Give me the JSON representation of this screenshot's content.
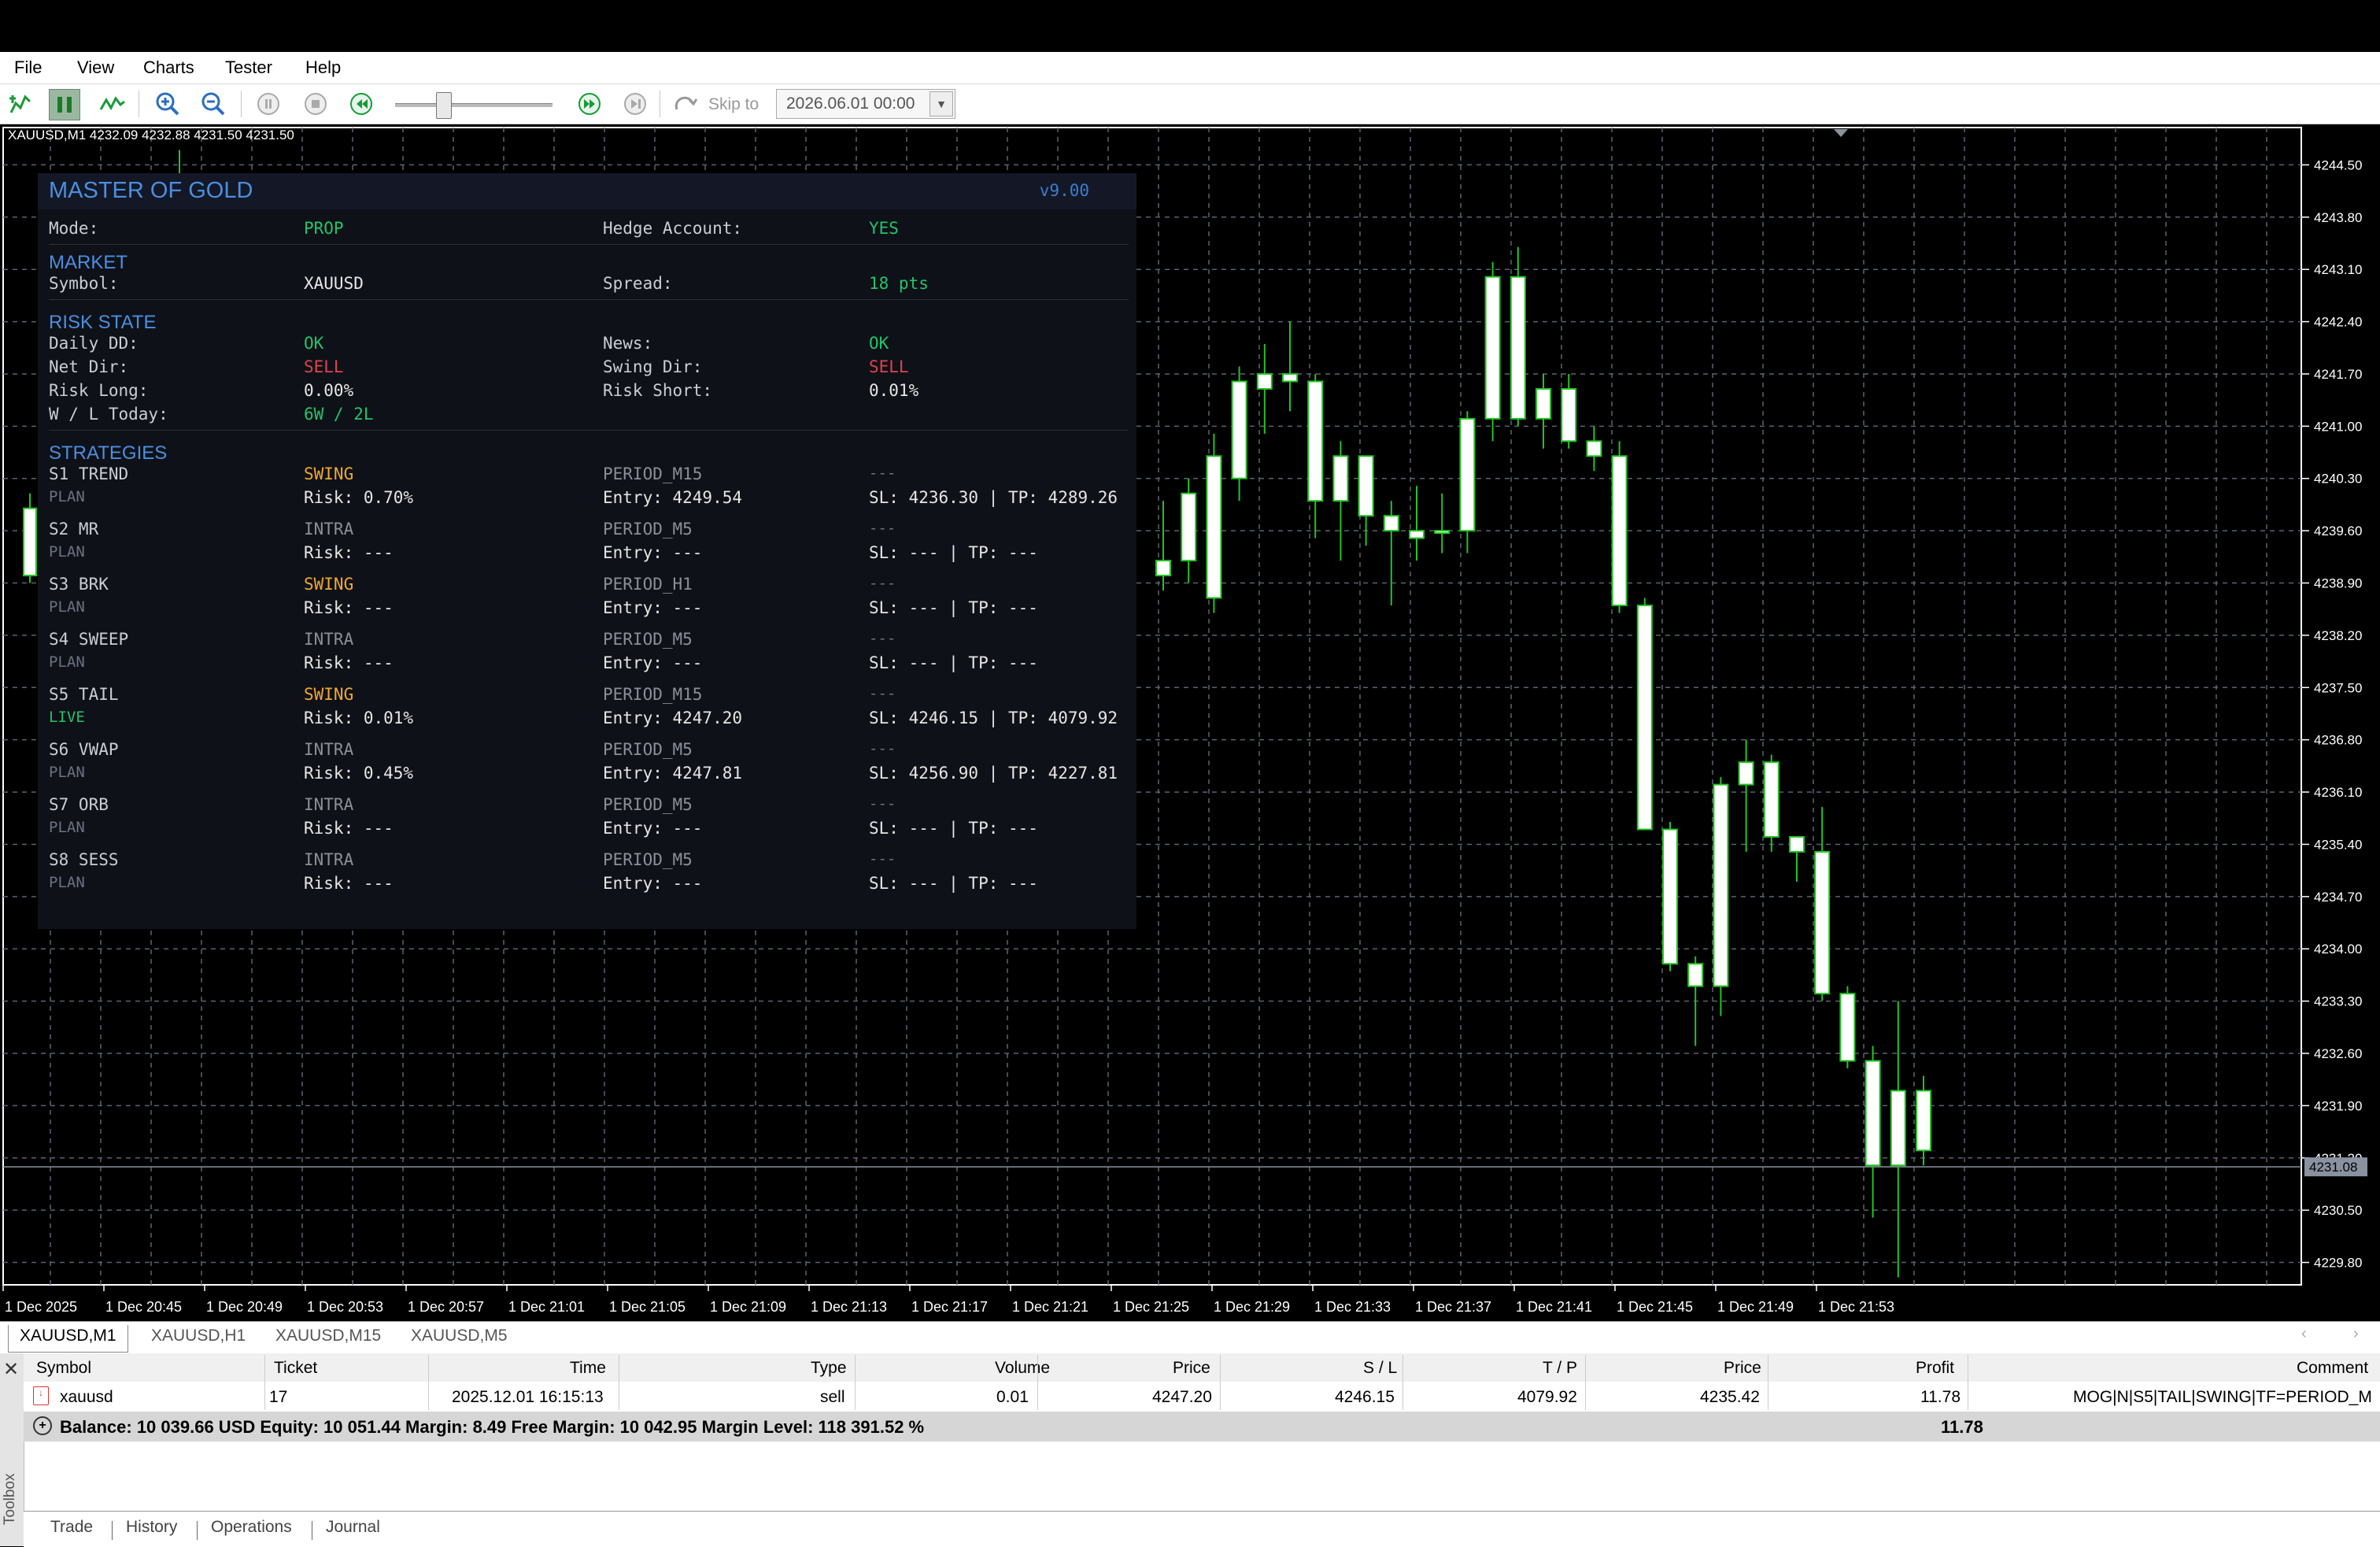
{
  "menu": [
    "File",
    "View",
    "Charts",
    "Tester",
    "Help"
  ],
  "toolbar": {
    "skip_label": "Skip to",
    "skip_date": "2026.06.01 00:00",
    "icons": [
      "new-order-icon",
      "pause-icon",
      "indicators-icon",
      "zoom-in-icon",
      "zoom-out-icon",
      "stop-icon",
      "stop-square-icon",
      "rewind-icon",
      "fast-forward-icon",
      "step-icon",
      "skip-to-icon"
    ]
  },
  "chart": {
    "title": "XAUUSD,M1  4232.09 4232.88 4231.50 4231.50",
    "price_labels": [
      "4244.50",
      "4243.80",
      "4243.10",
      "4242.40",
      "4241.70",
      "4241.00",
      "4240.30",
      "4239.60",
      "4238.90",
      "4238.20",
      "4237.50",
      "4236.80",
      "4236.10",
      "4235.40",
      "4234.70",
      "4234.00",
      "4233.30",
      "4232.60",
      "4231.90",
      "4231.20",
      "4230.50",
      "4229.80"
    ],
    "current_price": "4231.08",
    "time_labels": [
      "1 Dec 2025",
      "1 Dec 20:45",
      "1 Dec 20:49",
      "1 Dec 20:53",
      "1 Dec 20:57",
      "1 Dec 21:01",
      "1 Dec 21:05",
      "1 Dec 21:09",
      "1 Dec 21:13",
      "1 Dec 21:17",
      "1 Dec 21:21",
      "1 Dec 21:25",
      "1 Dec 21:29",
      "1 Dec 21:33",
      "1 Dec 21:37",
      "1 Dec 21:41",
      "1 Dec 21:45",
      "1 Dec 21:49",
      "1 Dec 21:53"
    ],
    "colors": {
      "background": "#000000",
      "grid": "#5a6270",
      "bull": "#ffffff",
      "wick": "#22c422",
      "axis_text": "#ffffff"
    }
  },
  "chart_data": {
    "type": "candlestick",
    "symbol": "XAUUSD,M1",
    "ylim": [
      4229.5,
      4245.0
    ],
    "candles": [
      {
        "o": 4239.0,
        "h": 4240.0,
        "l": 4238.8,
        "c": 4239.2
      },
      {
        "o": 4239.2,
        "h": 4240.3,
        "l": 4238.9,
        "c": 4240.1
      },
      {
        "o": 4238.7,
        "h": 4240.9,
        "l": 4238.5,
        "c": 4240.6
      },
      {
        "o": 4240.3,
        "h": 4241.8,
        "l": 4240.0,
        "c": 4241.6
      },
      {
        "o": 4241.5,
        "h": 4242.1,
        "l": 4240.9,
        "c": 4241.7
      },
      {
        "o": 4241.7,
        "h": 4242.4,
        "l": 4241.2,
        "c": 4241.6
      },
      {
        "o": 4241.6,
        "h": 4241.7,
        "l": 4239.5,
        "c": 4240.0
      },
      {
        "o": 4240.0,
        "h": 4240.8,
        "l": 4239.2,
        "c": 4240.6
      },
      {
        "o": 4240.6,
        "h": 4240.6,
        "l": 4239.4,
        "c": 4239.8
      },
      {
        "o": 4239.8,
        "h": 4240.0,
        "l": 4238.6,
        "c": 4239.6
      },
      {
        "o": 4239.6,
        "h": 4240.2,
        "l": 4239.2,
        "c": 4239.5
      },
      {
        "o": 4239.6,
        "h": 4240.1,
        "l": 4239.3,
        "c": 4239.6
      },
      {
        "o": 4239.6,
        "h": 4241.2,
        "l": 4239.3,
        "c": 4241.1
      },
      {
        "o": 4241.1,
        "h": 4243.2,
        "l": 4240.8,
        "c": 4243.0
      },
      {
        "o": 4241.1,
        "h": 4243.4,
        "l": 4241.0,
        "c": 4243.0
      },
      {
        "o": 4241.1,
        "h": 4241.7,
        "l": 4240.7,
        "c": 4241.5
      },
      {
        "o": 4241.5,
        "h": 4241.7,
        "l": 4240.7,
        "c": 4240.8
      },
      {
        "o": 4240.8,
        "h": 4241.0,
        "l": 4240.4,
        "c": 4240.6
      },
      {
        "o": 4240.6,
        "h": 4240.8,
        "l": 4238.5,
        "c": 4238.6
      },
      {
        "o": 4238.6,
        "h": 4238.7,
        "l": 4235.6,
        "c": 4235.6
      },
      {
        "o": 4235.6,
        "h": 4235.7,
        "l": 4233.7,
        "c": 4233.8
      },
      {
        "o": 4233.8,
        "h": 4233.9,
        "l": 4232.7,
        "c": 4233.5
      },
      {
        "o": 4233.5,
        "h": 4236.3,
        "l": 4233.1,
        "c": 4236.2
      },
      {
        "o": 4236.2,
        "h": 4236.8,
        "l": 4235.3,
        "c": 4236.5
      },
      {
        "o": 4236.5,
        "h": 4236.6,
        "l": 4235.3,
        "c": 4235.5
      },
      {
        "o": 4235.5,
        "h": 4235.5,
        "l": 4234.9,
        "c": 4235.3
      },
      {
        "o": 4235.3,
        "h": 4235.9,
        "l": 4233.3,
        "c": 4233.4
      },
      {
        "o": 4233.4,
        "h": 4233.5,
        "l": 4232.4,
        "c": 4232.5
      },
      {
        "o": 4232.5,
        "h": 4232.7,
        "l": 4230.4,
        "c": 4231.1
      },
      {
        "o": 4231.1,
        "h": 4233.3,
        "l": 4229.6,
        "c": 4232.1
      },
      {
        "o": 4232.1,
        "h": 4232.3,
        "l": 4231.1,
        "c": 4231.3
      }
    ]
  },
  "ea": {
    "title": "MASTER OF GOLD",
    "version": "v9.00",
    "mode_label": "Mode:",
    "mode": "PROP",
    "hedge_label": "Hedge Account:",
    "hedge": "YES",
    "market_title": "MARKET",
    "symbol_label": "Symbol:",
    "symbol": "XAUUSD",
    "spread_label": "Spread:",
    "spread": "18 pts",
    "risk_title": "RISK STATE",
    "daily_dd_label": "Daily DD:",
    "daily_dd": "OK",
    "news_label": "News:",
    "news": "OK",
    "net_dir_label": "Net Dir:",
    "net_dir": "SELL",
    "swing_dir_label": "Swing Dir:",
    "swing_dir": "SELL",
    "risk_long_label": "Risk Long:",
    "risk_long": "0.00%",
    "risk_short_label": "Risk Short:",
    "risk_short": "0.01%",
    "wl_label": "W / L Today:",
    "wl": "6W / 2L",
    "strategies_title": "STRATEGIES",
    "strategies": [
      {
        "name": "S1 TREND",
        "state": "PLAN",
        "style": "SWING",
        "risk": "Risk: 0.70%",
        "period": "PERIOD_M15",
        "entry": "Entry: 4249.54",
        "dashes": "---",
        "sltp": "SL: 4236.30 | TP: 4289.26"
      },
      {
        "name": "S2 MR",
        "state": "PLAN",
        "style": "INTRA",
        "risk": "Risk: ---",
        "period": "PERIOD_M5",
        "entry": "Entry: ---",
        "dashes": "---",
        "sltp": "SL: --- | TP: ---"
      },
      {
        "name": "S3 BRK",
        "state": "PLAN",
        "style": "SWING",
        "risk": "Risk: ---",
        "period": "PERIOD_H1",
        "entry": "Entry: ---",
        "dashes": "---",
        "sltp": "SL: --- | TP: ---"
      },
      {
        "name": "S4 SWEEP",
        "state": "PLAN",
        "style": "INTRA",
        "risk": "Risk: ---",
        "period": "PERIOD_M5",
        "entry": "Entry: ---",
        "dashes": "---",
        "sltp": "SL: --- | TP: ---"
      },
      {
        "name": "S5 TAIL",
        "state": "LIVE",
        "style": "SWING",
        "risk": "Risk: 0.01%",
        "period": "PERIOD_M15",
        "entry": "Entry: 4247.20",
        "dashes": "---",
        "sltp": "SL: 4246.15 | TP: 4079.92"
      },
      {
        "name": "S6 VWAP",
        "state": "PLAN",
        "style": "INTRA",
        "risk": "Risk: 0.45%",
        "period": "PERIOD_M5",
        "entry": "Entry: 4247.81",
        "dashes": "---",
        "sltp": "SL: 4256.90 | TP: 4227.81"
      },
      {
        "name": "S7 ORB",
        "state": "PLAN",
        "style": "INTRA",
        "risk": "Risk: ---",
        "period": "PERIOD_M5",
        "entry": "Entry: ---",
        "dashes": "---",
        "sltp": "SL: --- | TP: ---"
      },
      {
        "name": "S8 SESS",
        "state": "PLAN",
        "style": "INTRA",
        "risk": "Risk: ---",
        "period": "PERIOD_M5",
        "entry": "Entry: ---",
        "dashes": "---",
        "sltp": "SL: --- | TP: ---"
      }
    ]
  },
  "chart_tabs": [
    "XAUUSD,M1",
    "XAUUSD,H1",
    "XAUUSD,M15",
    "XAUUSD,M5"
  ],
  "terminal": {
    "toolbox_label": "Toolbox",
    "headers": {
      "symbol": "Symbol",
      "ticket": "Ticket",
      "time": "Time",
      "type": "Type",
      "volume": "Volume",
      "price": "Price",
      "sl": "S / L",
      "tp": "T / P",
      "cur_price": "Price",
      "profit": "Profit",
      "comment": "Comment"
    },
    "row": {
      "symbol": "xauusd",
      "ticket": "17",
      "time": "2025.12.01 16:15:13",
      "type": "sell",
      "volume": "0.01",
      "price": "4247.20",
      "sl": "4246.15",
      "tp": "4079.92",
      "cur_price": "4235.42",
      "profit": "11.78",
      "comment": "MOG|N|S5|TAIL|SWING|TF=PERIOD_M"
    },
    "balance": "Balance: 10 039.66 USD  Equity: 10 051.44  Margin: 8.49  Free Margin: 10 042.95  Margin Level: 118 391.52 %",
    "balance_profit": "11.78",
    "tabs": [
      "Trade",
      "History",
      "Operations",
      "Journal"
    ]
  }
}
